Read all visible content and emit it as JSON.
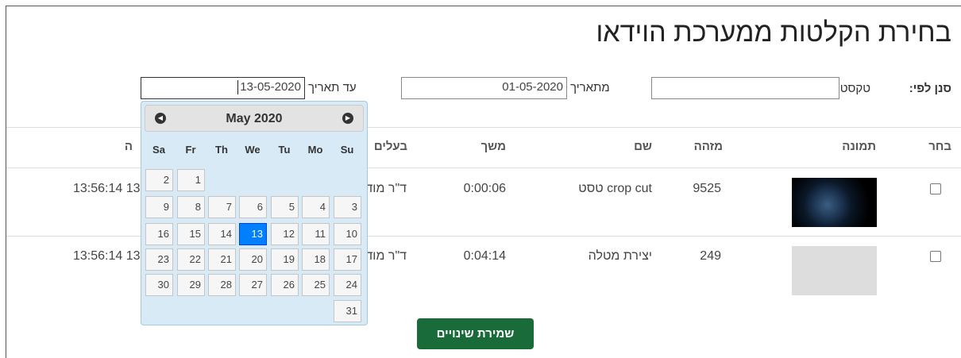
{
  "title": "בחירת הקלטות ממערכת הוידאו",
  "filter": {
    "label": "סנן לפי:",
    "text_label": "טקסט",
    "text_value": "",
    "from_label": "מתאריך",
    "from_value": "01-05-2020",
    "to_label": "עד תאריך",
    "to_value": "13-05-2020"
  },
  "table": {
    "headers": [
      "בחר",
      "תמונה",
      "מזהה",
      "שם",
      "משך",
      "בעלים",
      "ה"
    ],
    "rows": [
      {
        "checked": false,
        "thumbnail": "planet-image",
        "id": "9525",
        "name": "crop cut טסט",
        "duration": "0:00:06",
        "owner": "ד\"ר מוד",
        "date": "13:56:14 13"
      },
      {
        "checked": false,
        "thumbnail": "placeholder-image",
        "id": "249",
        "name": "יצירת מטלה",
        "duration": "0:04:14",
        "owner": "ד\"ר מוד",
        "date": "13:56:14 13"
      }
    ]
  },
  "datepicker": {
    "month_title": "May 2020",
    "prev_icon": "prev-month-icon",
    "next_icon": "next-month-icon",
    "days_of_week": [
      "Sa",
      "Fr",
      "Th",
      "We",
      "Tu",
      "Mo",
      "Su"
    ],
    "weeks": [
      [
        "2",
        "1",
        "",
        "",
        "",
        "",
        ""
      ],
      [
        "9",
        "8",
        "7",
        "6",
        "5",
        "4",
        "3"
      ],
      [
        "16",
        "15",
        "14",
        "13",
        "12",
        "11",
        "10"
      ],
      [
        "23",
        "22",
        "21",
        "20",
        "19",
        "18",
        "17"
      ],
      [
        "30",
        "29",
        "28",
        "27",
        "26",
        "25",
        "24"
      ],
      [
        "",
        "",
        "",
        "",
        "",
        "",
        "31"
      ]
    ],
    "selected_day": "13"
  },
  "save_button": "שמירת שינויים",
  "colors": {
    "save_button": "#1a6b3a",
    "selected_day": "#007fff",
    "datepicker_bg": "#d7eaf6"
  }
}
